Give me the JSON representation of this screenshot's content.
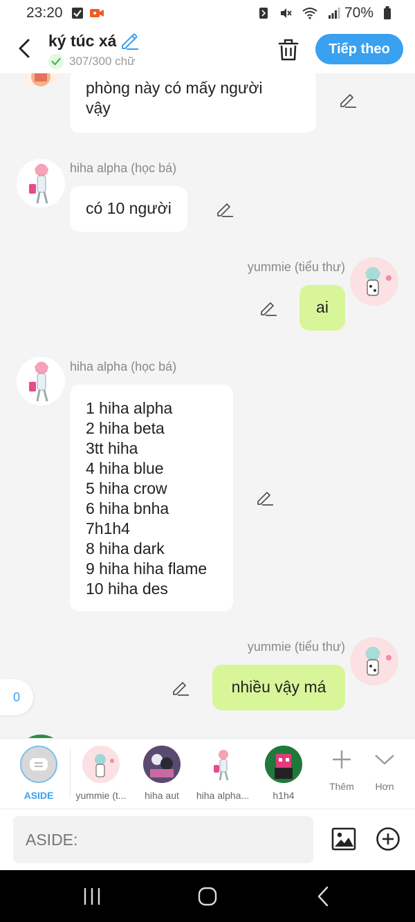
{
  "status_bar": {
    "time": "23:20",
    "battery": "70%",
    "icons": [
      "checkbox-notification-icon",
      "camera-notification-icon",
      "nfc-icon",
      "mute-icon",
      "wifi-icon",
      "signal-icon",
      "battery-icon"
    ]
  },
  "header": {
    "title": "ký túc xá",
    "word_count": "307/300 chữ",
    "next_label": "Tiếp theo",
    "accent": "#3aa0f0"
  },
  "messages": [
    {
      "sender": "",
      "text": "phòng này có mấy người\nvậy",
      "side": "left"
    },
    {
      "sender": "hiha alpha (học bá)",
      "text": "có 10 người",
      "side": "left"
    },
    {
      "sender": "yummie (tiểu thư)",
      "text": "ai",
      "side": "right"
    },
    {
      "sender": "hiha alpha (học bá)",
      "text": "1 hiha alpha\n2 hiha beta\n3tt hiha\n4 hiha blue\n5 hiha crow\n6 hiha bnha\n7h1h4\n8 hiha dark\n9 hiha hiha flame\n10 hiha des",
      "side": "left"
    },
    {
      "sender": "yummie (tiểu thư)",
      "text": "nhiều vậy má",
      "side": "right"
    }
  ],
  "counter": "0",
  "characters": {
    "aside": "ASIDE",
    "items": [
      "yummie (t...",
      "hiha aut",
      "hiha alpha...",
      "h1h4"
    ],
    "more_label": "Thêm",
    "expand_label": "Hơn"
  },
  "input": {
    "placeholder": "ASIDE:"
  },
  "colors": {
    "bubble_self": "#d9f59a",
    "bubble_other": "#ffffff",
    "background": "#f4f4f4"
  }
}
